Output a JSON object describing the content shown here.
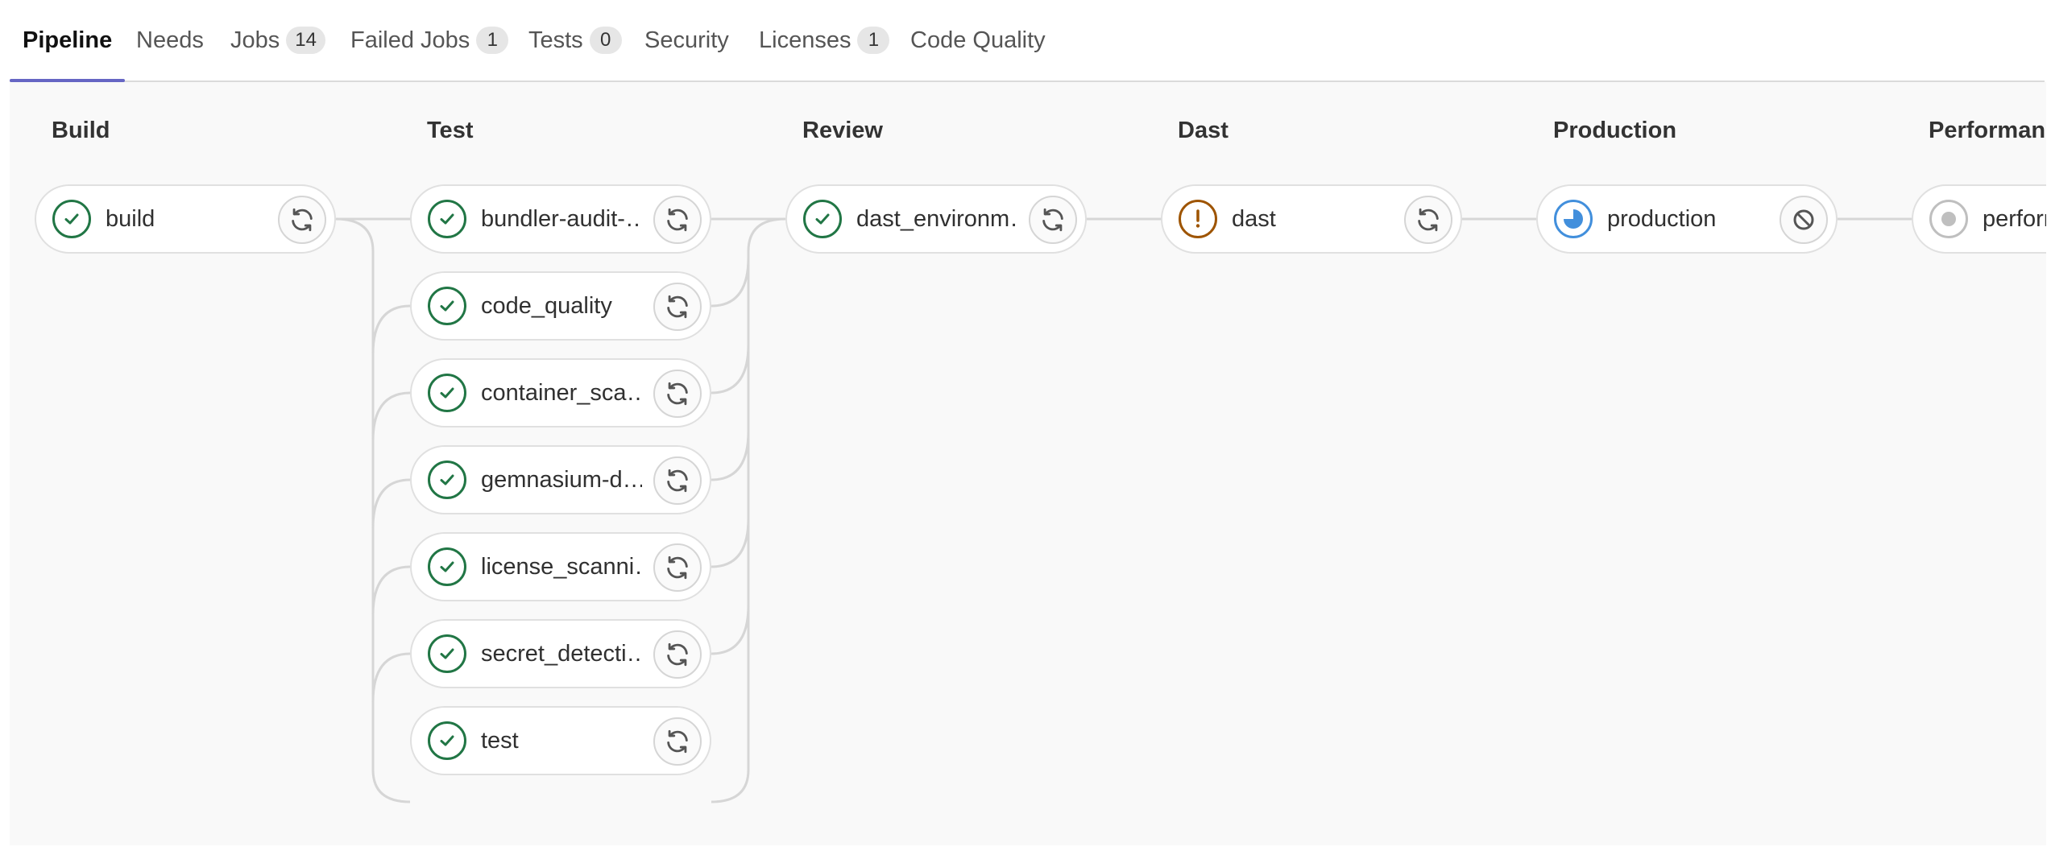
{
  "tabs": [
    {
      "label": "Pipeline",
      "badge": null
    },
    {
      "label": "Needs",
      "badge": null
    },
    {
      "label": "Jobs",
      "badge": "14"
    },
    {
      "label": "Failed Jobs",
      "badge": "1"
    },
    {
      "label": "Tests",
      "badge": "0"
    },
    {
      "label": "Security",
      "badge": null
    },
    {
      "label": "Licenses",
      "badge": "1"
    },
    {
      "label": "Code Quality",
      "badge": null
    }
  ],
  "stages": [
    {
      "title": "Build",
      "jobs": [
        {
          "name": "build",
          "status": "success",
          "action": "retry"
        }
      ]
    },
    {
      "title": "Test",
      "jobs": [
        {
          "name": "bundler-audit-…",
          "status": "success",
          "action": "retry"
        },
        {
          "name": "code_quality",
          "status": "success",
          "action": "retry"
        },
        {
          "name": "container_sca…",
          "status": "success",
          "action": "retry"
        },
        {
          "name": "gemnasium-d…",
          "status": "success",
          "action": "retry"
        },
        {
          "name": "license_scanni…",
          "status": "success",
          "action": "retry"
        },
        {
          "name": "secret_detecti…",
          "status": "success",
          "action": "retry"
        },
        {
          "name": "test",
          "status": "success",
          "action": "retry"
        }
      ]
    },
    {
      "title": "Review",
      "jobs": [
        {
          "name": "dast_environm…",
          "status": "success",
          "action": "retry"
        }
      ]
    },
    {
      "title": "Dast",
      "jobs": [
        {
          "name": "dast",
          "status": "warning",
          "action": "retry"
        }
      ]
    },
    {
      "title": "Production",
      "jobs": [
        {
          "name": "production",
          "status": "running",
          "action": "cancel"
        }
      ]
    },
    {
      "title": "Performance",
      "jobs": [
        {
          "name": "performance",
          "status": "created",
          "action": "play"
        }
      ]
    }
  ],
  "colors": {
    "success": "#217645",
    "warning": "#9e5400",
    "running": "#428fdc",
    "created": "#bfbfbf",
    "active_tab": "#6666c4"
  }
}
